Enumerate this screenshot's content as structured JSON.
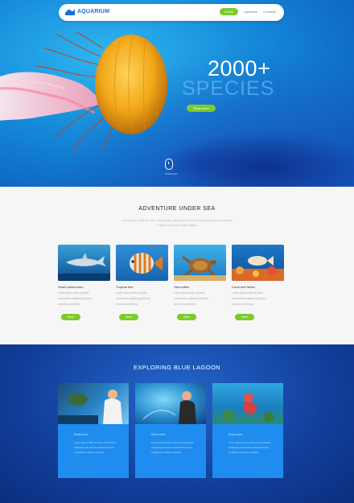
{
  "brand": {
    "name": "AQUARIUM"
  },
  "nav": {
    "items": [
      "Home",
      "Aquarium",
      "Contacts"
    ]
  },
  "hero": {
    "count": "2000+",
    "species": "SPECIES",
    "button": "Read more",
    "scroll_caption": "Scroll down"
  },
  "adventure": {
    "title": "ADVENTURE UNDER SEA",
    "subtitle": [
      "Lorem ipsum dolor sit amet, consectetur adipiscing elit, sed do eiusmod tempor incididunt",
      "ut labore et dolore magna aliqua"
    ],
    "cards": [
      {
        "title": "Shark adventures",
        "lines": [
          "Lorem ipsum dolor sit amet",
          "consectetur adipiscing elit sed",
          "do eiusmod tempor"
        ],
        "button": "More"
      },
      {
        "title": "Tropical fish",
        "lines": [
          "Lorem ipsum dolor sit amet",
          "consectetur adipiscing elit sed",
          "do eiusmod tempor"
        ],
        "button": "More"
      },
      {
        "title": "Sea turtles",
        "lines": [
          "Lorem ipsum dolor sit amet",
          "consectetur adipiscing elit sed",
          "do eiusmod tempor"
        ],
        "button": "More"
      },
      {
        "title": "Coral reef fishes",
        "lines": [
          "Lorem ipsum dolor sit amet",
          "consectetur adipiscing elit sed",
          "do eiusmod tempor"
        ],
        "button": "More"
      }
    ]
  },
  "exploring": {
    "title": "EXPLORING BLUE LAGOON",
    "cards": [
      {
        "label": "Read more",
        "lines": [
          "Lorem ipsum dolor sit amet consectetur",
          "adipiscing elit sed do eiusmod tempor",
          "incididunt ut labore et dolore"
        ]
      },
      {
        "label": "Read more",
        "lines": [
          "Lorem ipsum dolor sit amet consectetur",
          "adipiscing elit sed do eiusmod tempor",
          "incididunt ut labore et dolore"
        ]
      },
      {
        "label": "Read more",
        "lines": [
          "Lorem ipsum dolor sit amet consectetur",
          "adipiscing elit sed do eiusmod tempor",
          "incididunt ut labore et dolore"
        ]
      }
    ]
  },
  "colors": {
    "accent_green": "#7ccb2a",
    "brand_blue": "#1a6fd1",
    "ocean_deep": "#123f9c",
    "card_blue": "#1f8df0"
  }
}
